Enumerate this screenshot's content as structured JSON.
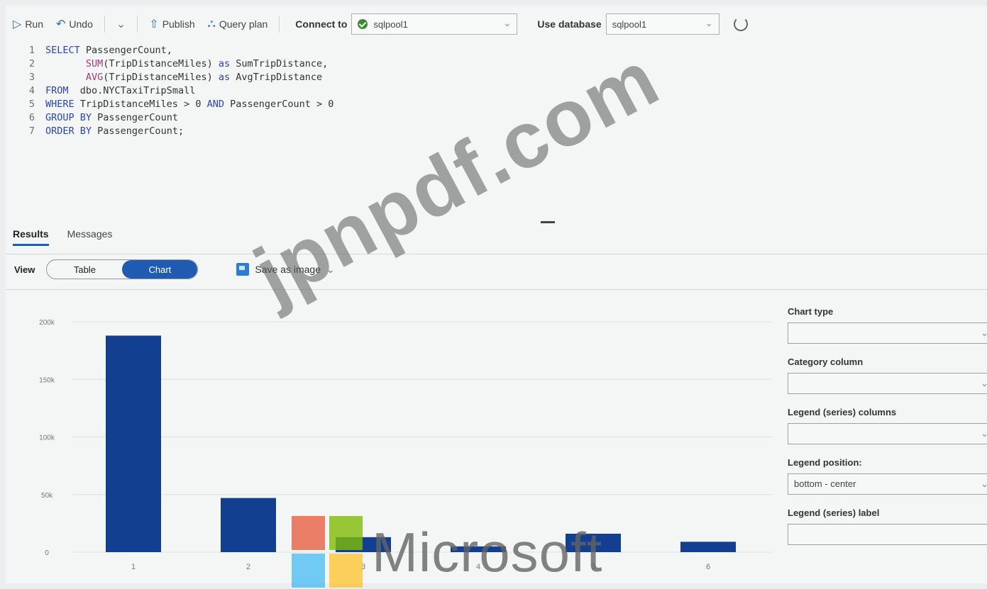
{
  "toolbar": {
    "run": "Run",
    "undo": "Undo",
    "publish": "Publish",
    "query_plan": "Query plan",
    "connect_to_label": "Connect to",
    "connect_to_value": "sqlpool1",
    "use_database_label": "Use database",
    "use_database_value": "sqlpool1"
  },
  "editor": {
    "lines": [
      {
        "n": "1",
        "text": "SELECT PassengerCount,"
      },
      {
        "n": "2",
        "text": "       SUM(TripDistanceMiles) as SumTripDistance,"
      },
      {
        "n": "3",
        "text": "       AVG(TripDistanceMiles) as AvgTripDistance"
      },
      {
        "n": "4",
        "text": "FROM  dbo.NYCTaxiTripSmall"
      },
      {
        "n": "5",
        "text": "WHERE TripDistanceMiles > 0 AND PassengerCount > 0"
      },
      {
        "n": "6",
        "text": "GROUP BY PassengerCount"
      },
      {
        "n": "7",
        "text": "ORDER BY PassengerCount;"
      }
    ]
  },
  "results": {
    "tabs": [
      "Results",
      "Messages"
    ],
    "view_label": "View",
    "toggle_table": "Table",
    "toggle_chart": "Chart",
    "save_as_image": "Save as image"
  },
  "chart_data": {
    "type": "bar",
    "categories": [
      "1",
      "2",
      "3",
      "4",
      "5",
      "6"
    ],
    "values": [
      188000,
      47000,
      13000,
      5000,
      16000,
      9000
    ],
    "yticks": [
      "200k",
      "150k",
      "100k",
      "50k",
      "0"
    ],
    "ylim": [
      0,
      200000
    ],
    "title": "",
    "xlabel": "",
    "ylabel": "",
    "bar_color": "#123f8f"
  },
  "panel": {
    "chart_type_label": "Chart type",
    "chart_type_value": "",
    "category_column_label": "Category column",
    "category_column_value": "",
    "legend_series_columns_label": "Legend (series) columns",
    "legend_series_columns_value": "",
    "legend_position_label": "Legend position:",
    "legend_position_value": "bottom - center",
    "legend_series_label_label": "Legend (series) label",
    "legend_series_label_value": ""
  },
  "watermark": {
    "text": "jpnpdf.com",
    "logo_word": "Microsoft"
  }
}
